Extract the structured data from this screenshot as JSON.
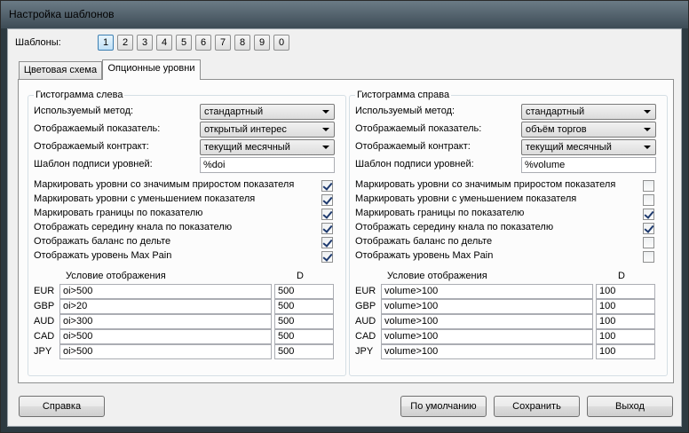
{
  "window": {
    "title": "Настройка шаблонов"
  },
  "templates": {
    "label": "Шаблоны:",
    "buttons": [
      "1",
      "2",
      "3",
      "4",
      "5",
      "6",
      "7",
      "8",
      "9",
      "0"
    ],
    "active": "1"
  },
  "tabs": [
    {
      "label": "Цветовая схема",
      "active": false
    },
    {
      "label": "Опционные уровни",
      "active": true
    }
  ],
  "left": {
    "title": "Гистограмма слева",
    "fields": [
      {
        "label": "Используемый метод:",
        "value": "стандартный",
        "type": "combo"
      },
      {
        "label": "Отображаемый показатель:",
        "value": "открытый интерес",
        "type": "combo"
      },
      {
        "label": "Отображаемый контракт:",
        "value": "текущий месячный",
        "type": "combo"
      },
      {
        "label": "Шаблон подписи уровней:",
        "value": "%doi",
        "type": "text"
      }
    ],
    "checks": [
      {
        "label": "Маркировать уровни со значимым приростом показателя",
        "checked": true
      },
      {
        "label": "Маркировать уровни с уменьшением показателя",
        "checked": true
      },
      {
        "label": "Маркировать границы по показателю",
        "checked": true
      },
      {
        "label": "Отображать середину кнала по показателю",
        "checked": true
      },
      {
        "label": "Отображать баланс по дельте",
        "checked": true
      },
      {
        "label": "Отображать уровень Max Pain",
        "checked": true
      }
    ],
    "table_header": {
      "condition": "Условие отображения",
      "d": "D"
    },
    "rows": [
      {
        "cur": "EUR",
        "condition": "oi>500",
        "d": "500"
      },
      {
        "cur": "GBP",
        "condition": "oi>20",
        "d": "500"
      },
      {
        "cur": "AUD",
        "condition": "oi>300",
        "d": "500"
      },
      {
        "cur": "CAD",
        "condition": "oi>500",
        "d": "500"
      },
      {
        "cur": "JPY",
        "condition": "oi>500",
        "d": "500"
      }
    ]
  },
  "right": {
    "title": "Гистограмма справа",
    "fields": [
      {
        "label": "Используемый метод:",
        "value": "стандартный",
        "type": "combo"
      },
      {
        "label": "Отображаемый показатель:",
        "value": "объём торгов",
        "type": "combo"
      },
      {
        "label": "Отображаемый контракт:",
        "value": "текущий месячный",
        "type": "combo"
      },
      {
        "label": "Шаблон подписи уровней:",
        "value": "%volume",
        "type": "text"
      }
    ],
    "checks": [
      {
        "label": "Маркировать уровни со значимым приростом показателя",
        "checked": false
      },
      {
        "label": "Маркировать уровни с уменьшением показателя",
        "checked": false
      },
      {
        "label": "Маркировать границы по показателю",
        "checked": true
      },
      {
        "label": "Отображать середину кнала по показателю",
        "checked": true
      },
      {
        "label": "Отображать баланс по дельте",
        "checked": false
      },
      {
        "label": "Отображать уровень Max Pain",
        "checked": false
      }
    ],
    "table_header": {
      "condition": "Условие отображения",
      "d": "D"
    },
    "rows": [
      {
        "cur": "EUR",
        "condition": "volume>100",
        "d": "100"
      },
      {
        "cur": "GBP",
        "condition": "volume>100",
        "d": "100"
      },
      {
        "cur": "AUD",
        "condition": "volume>100",
        "d": "100"
      },
      {
        "cur": "CAD",
        "condition": "volume>100",
        "d": "100"
      },
      {
        "cur": "JPY",
        "condition": "volume>100",
        "d": "100"
      }
    ]
  },
  "footer": {
    "help": "Справка",
    "default": "По умолчанию",
    "save": "Сохранить",
    "exit": "Выход"
  }
}
